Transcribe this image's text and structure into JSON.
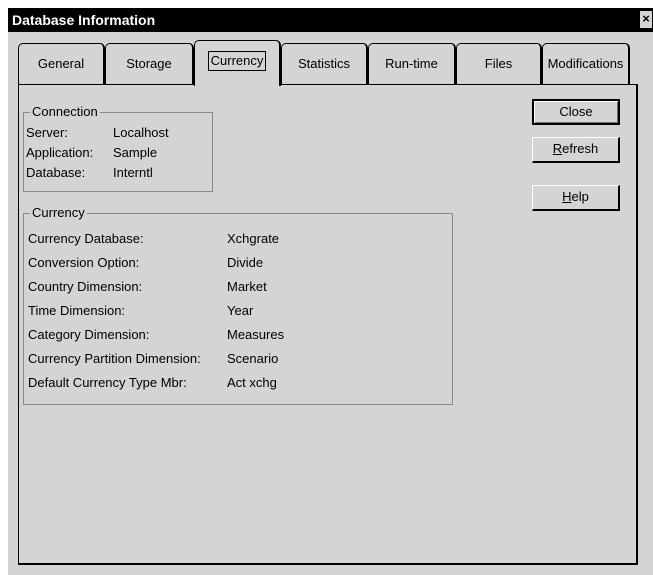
{
  "window": {
    "title": "Database Information",
    "close_glyph": "×"
  },
  "tabs": [
    {
      "label": "General"
    },
    {
      "label": "Storage"
    },
    {
      "label": "Currency",
      "selected": true
    },
    {
      "label": "Statistics"
    },
    {
      "label": "Run-time"
    },
    {
      "label": "Files"
    },
    {
      "label": "Modifications"
    }
  ],
  "connection": {
    "title": "Connection",
    "rows": [
      {
        "label": "Server:",
        "value": "Localhost"
      },
      {
        "label": "Application:",
        "value": "Sample"
      },
      {
        "label": "Database:",
        "value": "Interntl"
      }
    ]
  },
  "currency": {
    "title": "Currency",
    "rows": [
      {
        "label": "Currency Database:",
        "value": "Xchgrate"
      },
      {
        "label": "Conversion Option:",
        "value": "Divide"
      },
      {
        "label": "Country Dimension:",
        "value": "Market"
      },
      {
        "label": "Time Dimension:",
        "value": "Year"
      },
      {
        "label": "Category Dimension:",
        "value": "Measures"
      },
      {
        "label": "Currency Partition Dimension:",
        "value": "Scenario"
      },
      {
        "label": "Default Currency Type Mbr:",
        "value": "Act xchg"
      }
    ]
  },
  "buttons": {
    "close": "Close",
    "refresh_mnemonic": "R",
    "refresh_rest": "efresh",
    "help_mnemonic": "H",
    "help_rest": "elp"
  }
}
